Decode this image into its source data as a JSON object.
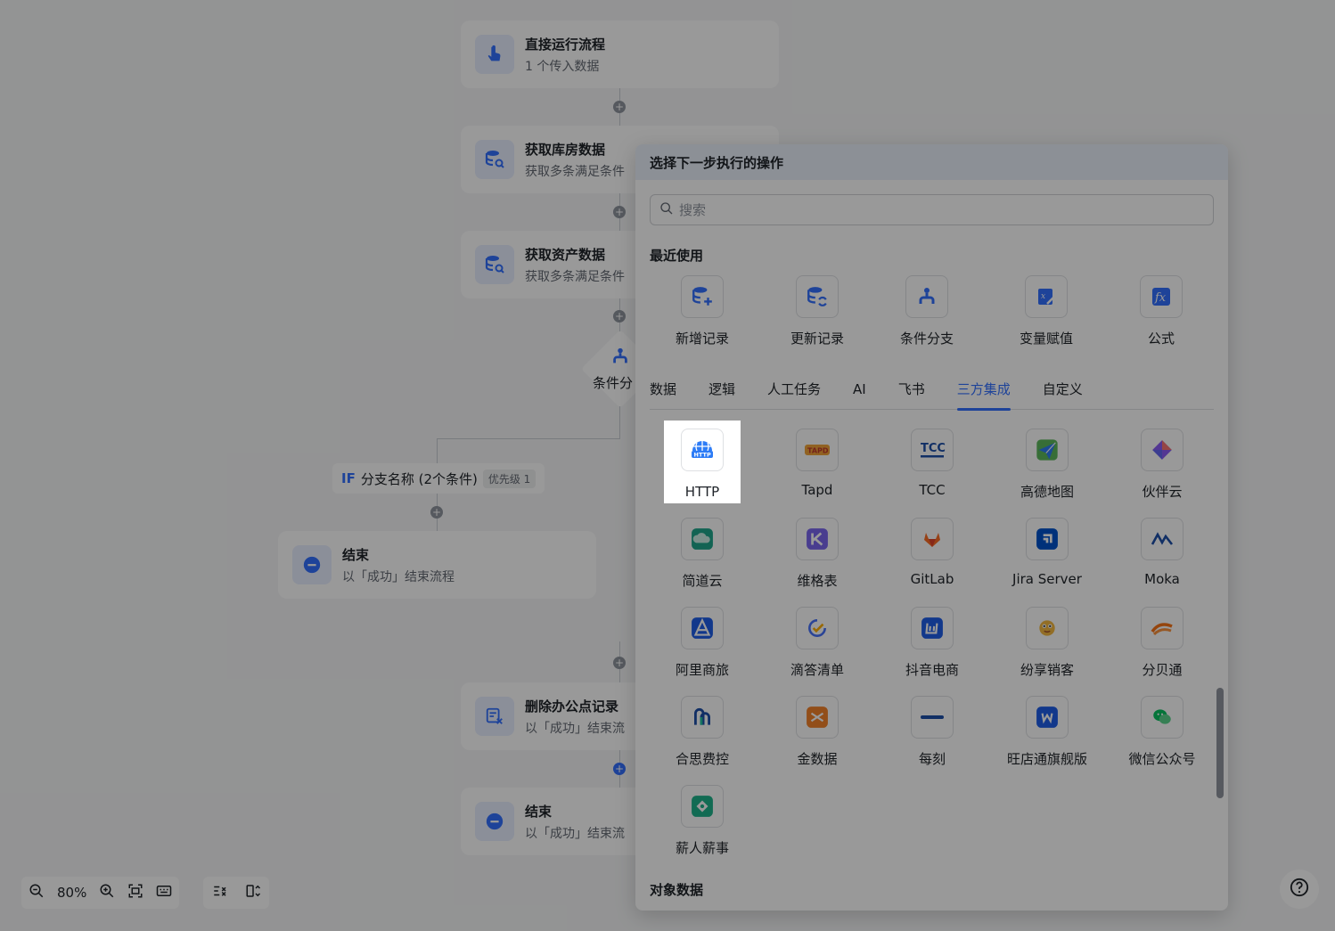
{
  "flow": {
    "nodes": [
      {
        "title": "直接运行流程",
        "subtitle": "1 个传入数据",
        "icon": "hand-pointer-icon"
      },
      {
        "title": "获取库房数据",
        "subtitle": "获取多条满足条件",
        "icon": "database-search-icon"
      },
      {
        "title": "获取资产数据",
        "subtitle": "获取多条满足条件",
        "icon": "database-search-icon"
      },
      {
        "title": "条件分",
        "icon": "branch-icon"
      },
      {
        "title": "删除办公点记录",
        "subtitle": "以「成功」结束流",
        "icon": "delete-record-icon"
      },
      {
        "title": "结束",
        "subtitle": "以「成功」结束流",
        "icon": "end-icon"
      }
    ],
    "branch": {
      "if": "IF",
      "name": "分支名称 (2个条件)",
      "priority": "优先级 1"
    },
    "branch_end": {
      "title": "结束",
      "subtitle": "以「成功」结束流程",
      "icon": "end-icon"
    }
  },
  "toolbar": {
    "zoom": "80%"
  },
  "panel": {
    "title": "选择下一步执行的操作",
    "search_placeholder": "搜索",
    "recent_title": "最近使用",
    "recent": [
      {
        "label": "新增记录",
        "icon": "add-record-icon"
      },
      {
        "label": "更新记录",
        "icon": "update-record-icon"
      },
      {
        "label": "条件分支",
        "icon": "branch-icon"
      },
      {
        "label": "变量赋值",
        "icon": "variable-assign-icon"
      },
      {
        "label": "公式",
        "icon": "formula-icon"
      }
    ],
    "tabs": [
      "数据",
      "逻辑",
      "人工任务",
      "AI",
      "飞书",
      "三方集成",
      "自定义"
    ],
    "active_tab": "三方集成",
    "integrations": [
      {
        "label": "HTTP",
        "icon": "http-icon"
      },
      {
        "label": "Tapd",
        "icon": "tapd-icon"
      },
      {
        "label": "TCC",
        "icon": "tcc-icon"
      },
      {
        "label": "高德地图",
        "icon": "amap-icon"
      },
      {
        "label": "伙伴云",
        "icon": "huoban-icon"
      },
      {
        "label": "简道云",
        "icon": "jiandaoyun-icon"
      },
      {
        "label": "维格表",
        "icon": "vika-icon"
      },
      {
        "label": "GitLab",
        "icon": "gitlab-icon"
      },
      {
        "label": "Jira Server",
        "icon": "jira-icon"
      },
      {
        "label": "Moka",
        "icon": "moka-icon"
      },
      {
        "label": "阿里商旅",
        "icon": "alitrip-icon"
      },
      {
        "label": "滴答清单",
        "icon": "ticktick-icon"
      },
      {
        "label": "抖音电商",
        "icon": "douyin-shop-icon"
      },
      {
        "label": "纷享销客",
        "icon": "fxiaoke-icon"
      },
      {
        "label": "分贝通",
        "icon": "fenbeitong-icon"
      },
      {
        "label": "合思费控",
        "icon": "hose-icon"
      },
      {
        "label": "金数据",
        "icon": "jinshuju-icon"
      },
      {
        "label": "每刻",
        "icon": "maycur-icon"
      },
      {
        "label": "旺店通旗舰版",
        "icon": "wangdiantong-icon"
      },
      {
        "label": "微信公众号",
        "icon": "wechat-mp-icon"
      },
      {
        "label": "薪人薪事",
        "icon": "xinrenxinshi-icon"
      }
    ],
    "object_title": "对象数据"
  },
  "colors": {
    "accent": "#3370ff",
    "overlay": "rgba(0,0,0,0.40)"
  }
}
